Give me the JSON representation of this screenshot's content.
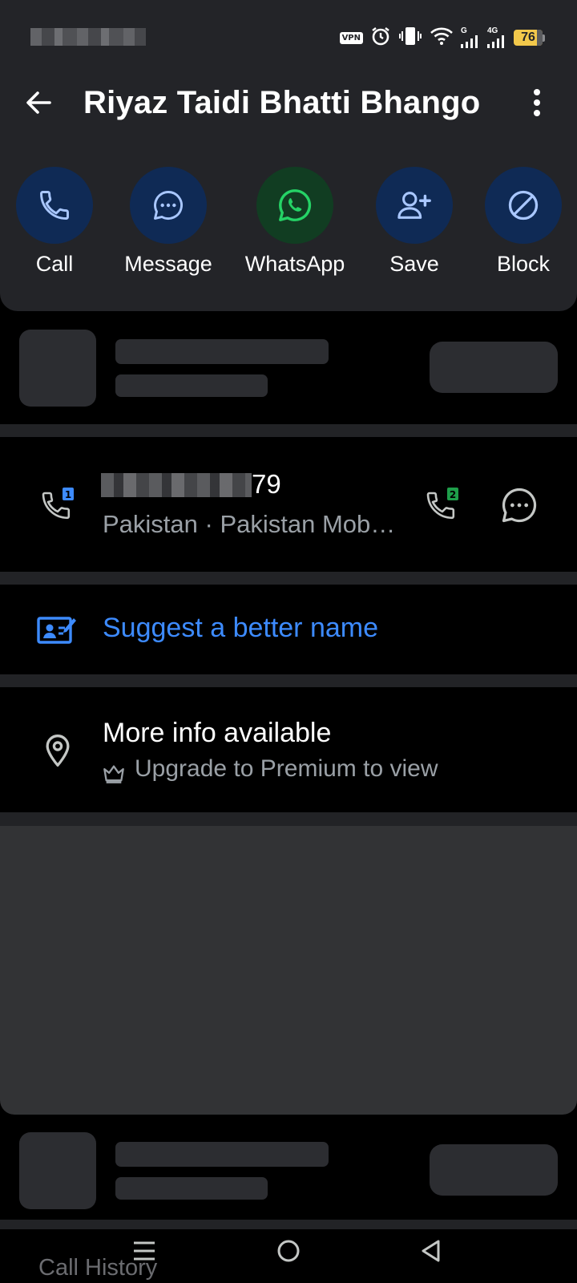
{
  "status_bar": {
    "vpn_label": "VPN",
    "network_1": "G",
    "network_2": "4G",
    "battery_level": "76"
  },
  "topbar": {
    "title": "Riyaz Taidi Bhatti Bhango"
  },
  "actions": [
    {
      "label": "Call",
      "icon": "phone-icon",
      "color": "#0f2a55"
    },
    {
      "label": "Message",
      "icon": "chat-bubble-icon",
      "color": "#0f2a55"
    },
    {
      "label": "WhatsApp",
      "icon": "whatsapp-icon",
      "color": "#113d22"
    },
    {
      "label": "Save",
      "icon": "add-contact-icon",
      "color": "#0f2a55"
    },
    {
      "label": "Block",
      "icon": "block-icon",
      "color": "#0f2a55"
    }
  ],
  "number_card": {
    "number_visible_suffix": "79",
    "carrier": "Pakistan · Pakistan Mobi…",
    "sim1_label": "1",
    "sim2_label": "2"
  },
  "suggest": {
    "label": "Suggest a better name"
  },
  "more_info": {
    "title": "More info available",
    "subtitle": "Upgrade to Premium to view"
  },
  "bottom_tab": {
    "label": "Call History"
  },
  "colors": {
    "accent_blue": "#3d8bff",
    "whatsapp_green": "#25d366",
    "header_bg": "#232428",
    "battery_yellow": "#f2c84b"
  }
}
